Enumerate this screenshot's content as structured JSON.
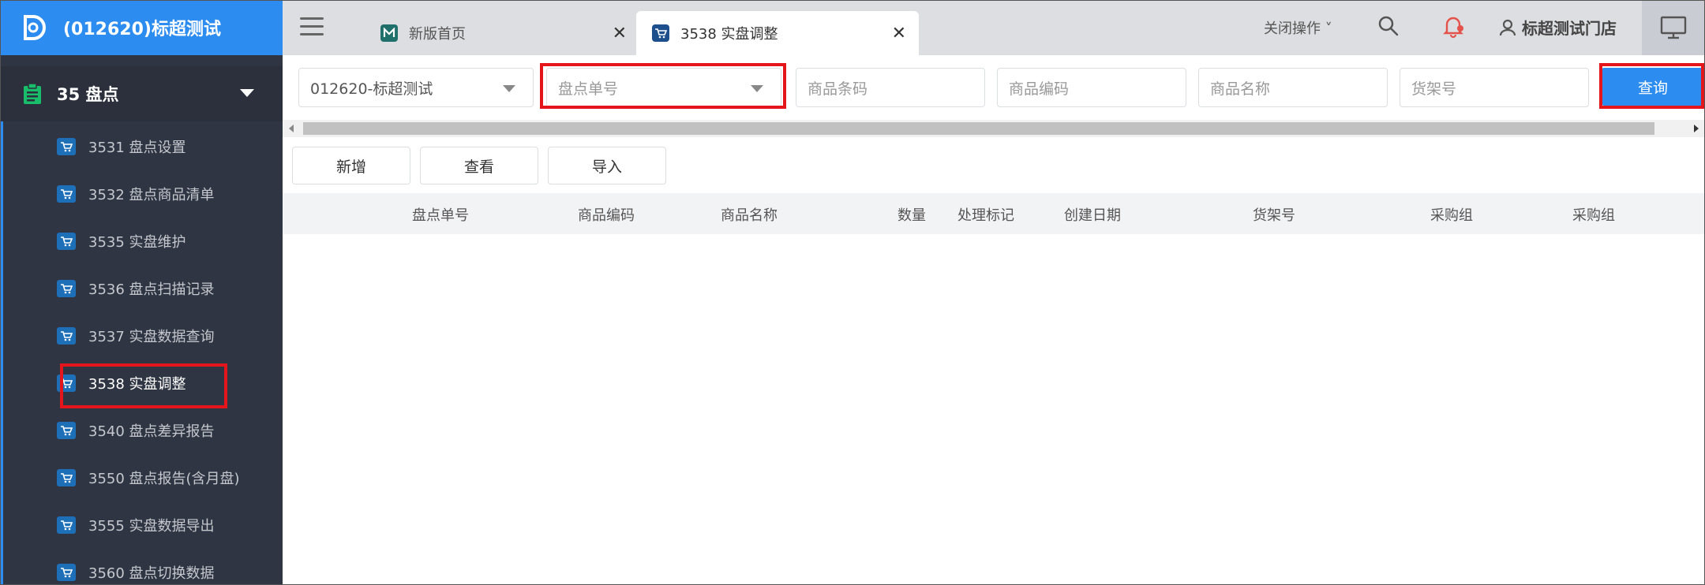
{
  "brand": {
    "title": "(012620)标超测试"
  },
  "sidebar": {
    "group": {
      "label": "35 盘点"
    },
    "items": [
      {
        "label": "3531 盘点设置"
      },
      {
        "label": "3532 盘点商品清单"
      },
      {
        "label": "3535 实盘维护"
      },
      {
        "label": "3536 盘点扫描记录"
      },
      {
        "label": "3537 实盘数据查询"
      },
      {
        "label": "3538 实盘调整"
      },
      {
        "label": "3540 盘点差异报告"
      },
      {
        "label": "3550 盘点报告(含月盘)"
      },
      {
        "label": "3555 实盘数据导出"
      },
      {
        "label": "3560 盘点切换数据"
      }
    ]
  },
  "tabs": [
    {
      "label": "新版首页"
    },
    {
      "label": "3538 实盘调整"
    }
  ],
  "header": {
    "close_ops": "关闭操作 ˅",
    "user": "标超测试门店"
  },
  "filters": {
    "store": "012620-标超测试",
    "order_no_placeholder": "盘点单号",
    "barcode_placeholder": "商品条码",
    "code_placeholder": "商品编码",
    "name_placeholder": "商品名称",
    "shelf_placeholder": "货架号",
    "query_label": "查询"
  },
  "actions": {
    "add": "新增",
    "view": "查看",
    "import": "导入"
  },
  "table": {
    "columns": [
      "盘点单号",
      "商品编码",
      "商品名称",
      "数量",
      "处理标记",
      "创建日期",
      "货架号",
      "采购组",
      "采购组"
    ]
  },
  "colors": {
    "brand": "#2d8cf0",
    "sidebar": "#2f3542",
    "highlight": "#e5161b"
  }
}
